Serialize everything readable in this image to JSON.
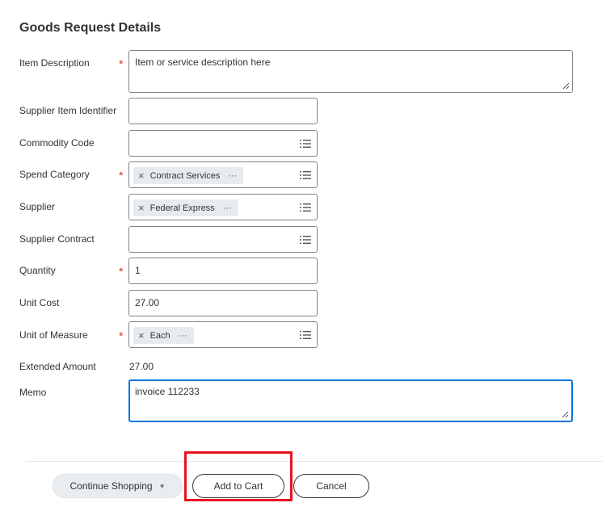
{
  "form": {
    "title": "Goods Request Details",
    "fields": {
      "item_description": {
        "label": "Item Description",
        "value": "Item or service description here",
        "required": true
      },
      "supplier_item_identifier": {
        "label": "Supplier Item Identifier",
        "value": ""
      },
      "commodity_code": {
        "label": "Commodity Code",
        "value": ""
      },
      "spend_category": {
        "label": "Spend Category",
        "value": "Contract Services",
        "required": true
      },
      "supplier": {
        "label": "Supplier",
        "value": "Federal Express"
      },
      "supplier_contract": {
        "label": "Supplier Contract",
        "value": ""
      },
      "quantity": {
        "label": "Quantity",
        "value": "1",
        "required": true
      },
      "unit_cost": {
        "label": "Unit Cost",
        "value": "27.00"
      },
      "unit_of_measure": {
        "label": "Unit of Measure",
        "value": "Each",
        "required": true
      },
      "extended_amount": {
        "label": "Extended Amount",
        "value": "27.00"
      },
      "memo": {
        "label": "Memo",
        "value": "invoice 112233"
      }
    },
    "required_marker": "*",
    "pill_more": "···",
    "pill_remove": "×"
  },
  "actions": {
    "continue_shopping": "Continue Shopping",
    "add_to_cart": "Add to Cart",
    "cancel": "Cancel"
  },
  "colors": {
    "required": "#de2e21",
    "focus": "#0875e1",
    "highlight": "#e8121f"
  },
  "icons": {
    "prompt": "prompt-list-icon",
    "remove": "remove-x-icon",
    "more": "more-dots-icon",
    "resize": "resize-grip-icon",
    "caret": "caret-down-icon"
  }
}
